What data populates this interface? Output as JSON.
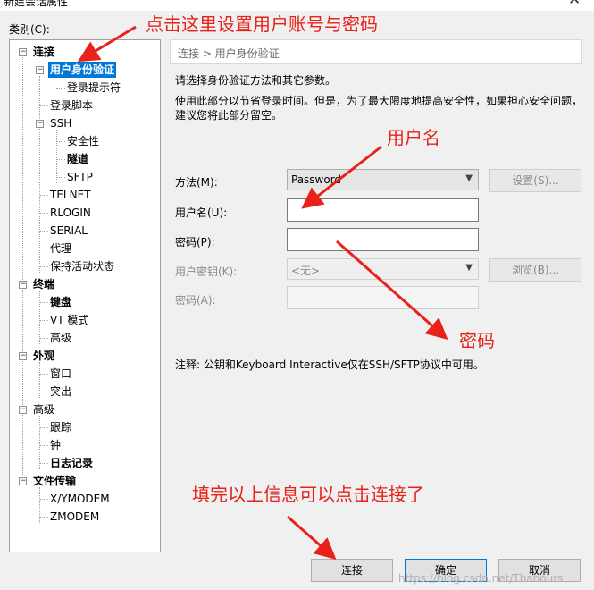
{
  "window": {
    "title": "新建会话属性",
    "close_glyph": "✕"
  },
  "category_label": "类别(C):",
  "tree": {
    "connection": "连接",
    "user_auth": "用户身份验证",
    "login_prompt": "登录提示符",
    "login_script": "登录脚本",
    "ssh": "SSH",
    "security": "安全性",
    "tunnel": "隧道",
    "sftp": "SFTP",
    "telnet": "TELNET",
    "rlogin": "RLOGIN",
    "serial": "SERIAL",
    "proxy": "代理",
    "keepalive": "保持活动状态",
    "terminal": "终端",
    "keyboard": "键盘",
    "vt_mode": "VT 模式",
    "advanced": "高级",
    "appearance": "外观",
    "window": "窗口",
    "highlight": "突出",
    "advanced2": "高级",
    "trace": "跟踪",
    "bell": "钟",
    "logging": "日志记录",
    "file_transfer": "文件传输",
    "xymodem": "X/YMODEM",
    "zmodem": "ZMODEM"
  },
  "breadcrumb": "连接 > 用户身份验证",
  "desc": {
    "line1": "请选择身份验证方法和其它参数。",
    "line2": "使用此部分以节省登录时间。但是，为了最大限度地提高安全性，如果担心安全问题，",
    "line3": "建议您将此部分留空。"
  },
  "form": {
    "method_label": "方法(M):",
    "method_value": "Password",
    "settings_button": "设置(S)...",
    "username_label": "用户名(U):",
    "username_value": "",
    "password_label": "密码(P):",
    "password_value": "",
    "userkey_label": "用户密钥(K):",
    "userkey_value": "<无>",
    "browse_button": "浏览(B)...",
    "passphrase_label": "密码(A):",
    "passphrase_value": ""
  },
  "note": "注释: 公钥和Keyboard Interactive仅在SSH/SFTP协议中可用。",
  "buttons": {
    "connect": "连接",
    "ok": "确定",
    "cancel": "取消"
  },
  "annotations": {
    "top": "点击这里设置用户账号与密码",
    "username": "用户名",
    "password": "密码",
    "bottom": "填完以上信息可以点击连接了"
  },
  "watermark": "https://blog.csdn.net/Thanours",
  "colors": {
    "selection": "#0078d7",
    "annotation": "#e8211a"
  }
}
